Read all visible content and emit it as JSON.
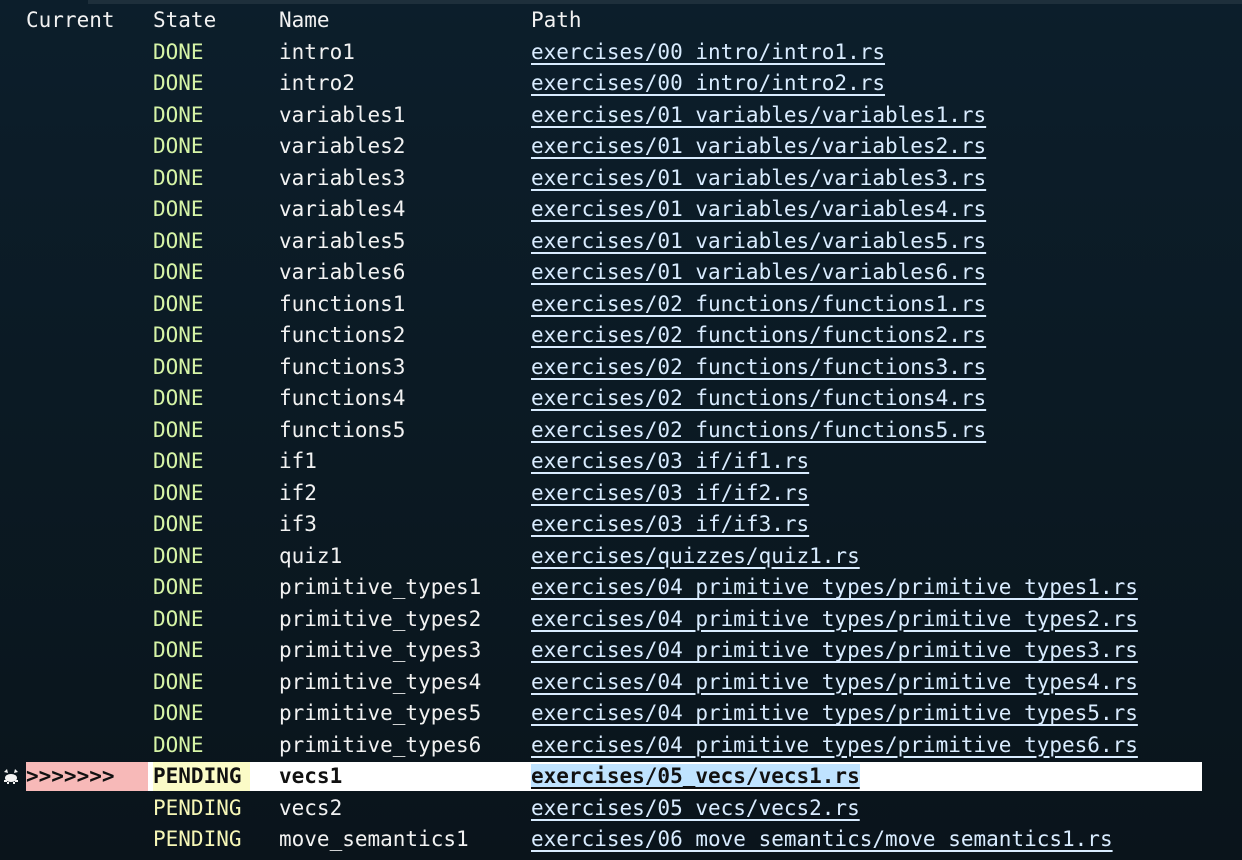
{
  "header": {
    "current": "Current",
    "state": "State",
    "name": "Name",
    "path": "Path"
  },
  "rows": [
    {
      "current": "",
      "state": "DONE",
      "name": "intro1",
      "path": "exercises/00_intro/intro1.rs",
      "selected": false
    },
    {
      "current": "",
      "state": "DONE",
      "name": "intro2",
      "path": "exercises/00_intro/intro2.rs",
      "selected": false
    },
    {
      "current": "",
      "state": "DONE",
      "name": "variables1",
      "path": "exercises/01_variables/variables1.rs",
      "selected": false
    },
    {
      "current": "",
      "state": "DONE",
      "name": "variables2",
      "path": "exercises/01_variables/variables2.rs",
      "selected": false
    },
    {
      "current": "",
      "state": "DONE",
      "name": "variables3",
      "path": "exercises/01_variables/variables3.rs",
      "selected": false
    },
    {
      "current": "",
      "state": "DONE",
      "name": "variables4",
      "path": "exercises/01_variables/variables4.rs",
      "selected": false
    },
    {
      "current": "",
      "state": "DONE",
      "name": "variables5",
      "path": "exercises/01_variables/variables5.rs",
      "selected": false
    },
    {
      "current": "",
      "state": "DONE",
      "name": "variables6",
      "path": "exercises/01_variables/variables6.rs",
      "selected": false
    },
    {
      "current": "",
      "state": "DONE",
      "name": "functions1",
      "path": "exercises/02_functions/functions1.rs",
      "selected": false
    },
    {
      "current": "",
      "state": "DONE",
      "name": "functions2",
      "path": "exercises/02_functions/functions2.rs",
      "selected": false
    },
    {
      "current": "",
      "state": "DONE",
      "name": "functions3",
      "path": "exercises/02_functions/functions3.rs",
      "selected": false
    },
    {
      "current": "",
      "state": "DONE",
      "name": "functions4",
      "path": "exercises/02_functions/functions4.rs",
      "selected": false
    },
    {
      "current": "",
      "state": "DONE",
      "name": "functions5",
      "path": "exercises/02_functions/functions5.rs",
      "selected": false
    },
    {
      "current": "",
      "state": "DONE",
      "name": "if1",
      "path": "exercises/03_if/if1.rs",
      "selected": false
    },
    {
      "current": "",
      "state": "DONE",
      "name": "if2",
      "path": "exercises/03_if/if2.rs",
      "selected": false
    },
    {
      "current": "",
      "state": "DONE",
      "name": "if3",
      "path": "exercises/03_if/if3.rs",
      "selected": false
    },
    {
      "current": "",
      "state": "DONE",
      "name": "quiz1",
      "path": "exercises/quizzes/quiz1.rs",
      "selected": false
    },
    {
      "current": "",
      "state": "DONE",
      "name": "primitive_types1",
      "path": "exercises/04_primitive_types/primitive_types1.rs",
      "selected": false
    },
    {
      "current": "",
      "state": "DONE",
      "name": "primitive_types2",
      "path": "exercises/04_primitive_types/primitive_types2.rs",
      "selected": false
    },
    {
      "current": "",
      "state": "DONE",
      "name": "primitive_types3",
      "path": "exercises/04_primitive_types/primitive_types3.rs",
      "selected": false
    },
    {
      "current": "",
      "state": "DONE",
      "name": "primitive_types4",
      "path": "exercises/04_primitive_types/primitive_types4.rs",
      "selected": false
    },
    {
      "current": "",
      "state": "DONE",
      "name": "primitive_types5",
      "path": "exercises/04_primitive_types/primitive_types5.rs",
      "selected": false
    },
    {
      "current": "",
      "state": "DONE",
      "name": "primitive_types6",
      "path": "exercises/04_primitive_types/primitive_types6.rs",
      "selected": false
    },
    {
      "current": ">>>>>>>",
      "state": "PENDING",
      "name": "vecs1",
      "path": "exercises/05_vecs/vecs1.rs",
      "selected": true
    },
    {
      "current": "",
      "state": "PENDING",
      "name": "vecs2",
      "path": "exercises/05_vecs/vecs2.rs",
      "selected": false
    },
    {
      "current": "",
      "state": "PENDING",
      "name": "move_semantics1",
      "path": "exercises/06_move_semantics/move_semantics1.rs",
      "selected": false
    }
  ],
  "selection_marker": {
    "icon": "crab-icon"
  },
  "colors": {
    "background": "#0b1a24",
    "done": "#d7f5a7",
    "pending": "#f7f7b7",
    "path": "#d9ecff",
    "current_highlight": "#f7b9b8",
    "state_highlight": "#fbfbc7",
    "path_highlight": "#bfe3ff"
  }
}
